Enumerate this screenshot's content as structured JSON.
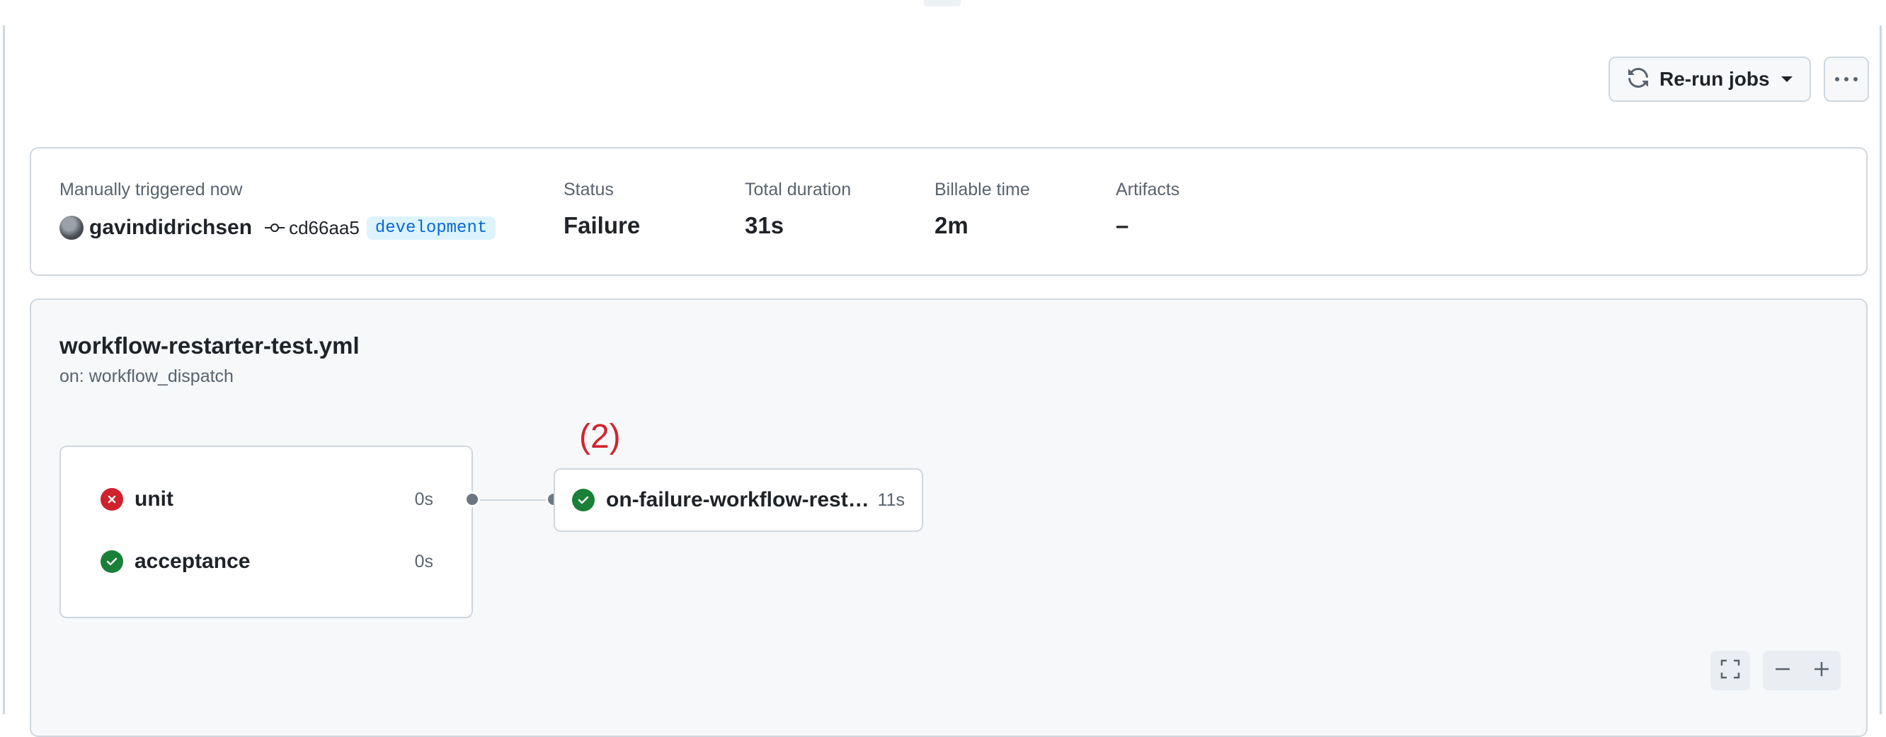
{
  "header": {
    "rerun_label": "Re-run jobs"
  },
  "summary": {
    "trigger_label": "Manually triggered now",
    "username": "gavindidrichsen",
    "commit_sha": "cd66aa5",
    "branch": "development",
    "status_label": "Status",
    "status_value": "Failure",
    "duration_label": "Total duration",
    "duration_value": "31s",
    "billable_label": "Billable time",
    "billable_value": "2m",
    "artifacts_label": "Artifacts",
    "artifacts_value": "–"
  },
  "workflow": {
    "file_name": "workflow-restarter-test.yml",
    "trigger": "on: workflow_dispatch",
    "annotation": "(2)",
    "jobs": [
      {
        "name": "unit",
        "duration": "0s",
        "status": "failure"
      },
      {
        "name": "acceptance",
        "duration": "0s",
        "status": "success"
      }
    ],
    "downstream_job": {
      "name": "on-failure-workflow-restarter",
      "duration": "11s",
      "status": "success"
    }
  },
  "colors": {
    "failure": "#cf222e",
    "success": "#1a7f37",
    "annotation": "#d1242f",
    "branch_text": "#0969da"
  },
  "icons": [
    "sync-icon",
    "caret-down-icon",
    "kebab-horizontal-icon",
    "git-commit-icon",
    "x-circle-icon",
    "check-circle-icon",
    "fullscreen-icon",
    "zoom-out-icon",
    "zoom-in-icon"
  ]
}
